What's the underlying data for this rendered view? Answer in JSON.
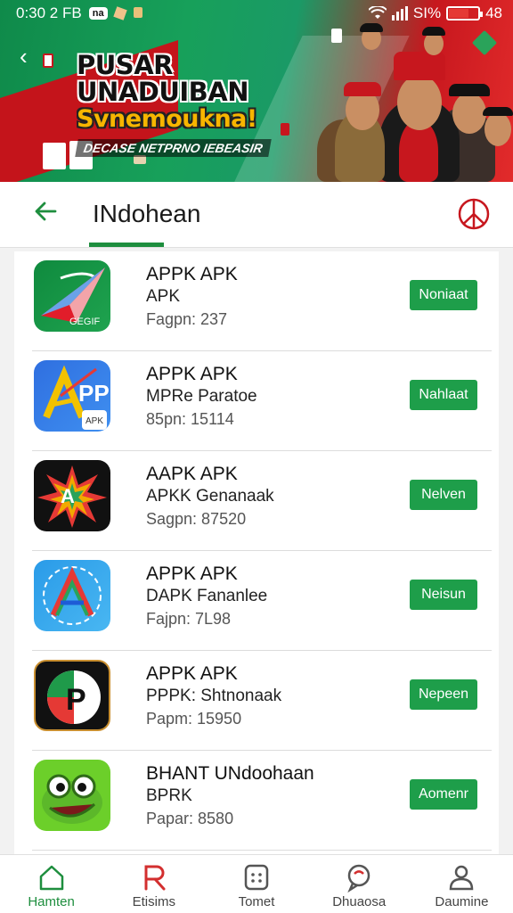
{
  "status": {
    "time": "0:30 2 FB",
    "badge": "na",
    "signal": "SI%",
    "battery_text": "48"
  },
  "banner": {
    "headline1": "PUSAR UNADUIBAN",
    "headline2": "Svnemoukna!",
    "headline3": "DECASE NETPRNO IEBEASIR"
  },
  "header": {
    "title": "INdohean"
  },
  "apps": [
    {
      "name": "APPK APK",
      "subtitle": "APK",
      "meta": "Fagpn: 237",
      "button": "Noniaat",
      "icon": "paper-plane-icon"
    },
    {
      "name": "APPK APK",
      "subtitle": "MPRe Paratoe",
      "meta": "85pn: 15114",
      "button": "Nahlaat",
      "icon": "app-a-icon"
    },
    {
      "name": "AAPK APK",
      "subtitle": "APKK Genanaak",
      "meta": "Sagpn: 87520",
      "button": "Nelven",
      "icon": "star-burst-icon"
    },
    {
      "name": "APPK APK",
      "subtitle": "DAPK Fananlee",
      "meta": "Fajpn: 7L98",
      "button": "Neisun",
      "icon": "triangle-a-icon"
    },
    {
      "name": "APPK APK",
      "subtitle": "PPPK: Shtnonaak",
      "meta": "Papm: 15950",
      "button": "Nepeen",
      "icon": "flag-p-icon"
    },
    {
      "name": "BHANT UNdoohaan",
      "subtitle": "BPRK",
      "meta": "Papar: 8580",
      "button": "Aomenr",
      "icon": "frog-icon"
    }
  ],
  "nav": [
    {
      "label": "Hamten",
      "icon": "home-icon"
    },
    {
      "label": "Etisims",
      "icon": "r-icon"
    },
    {
      "label": "Tomet",
      "icon": "grid-icon"
    },
    {
      "label": "Dhuaosa",
      "icon": "chat-icon"
    },
    {
      "label": "Daumine",
      "icon": "user-icon"
    }
  ],
  "colors": {
    "primary": "#1e8e3e",
    "accent": "#c7171e"
  }
}
